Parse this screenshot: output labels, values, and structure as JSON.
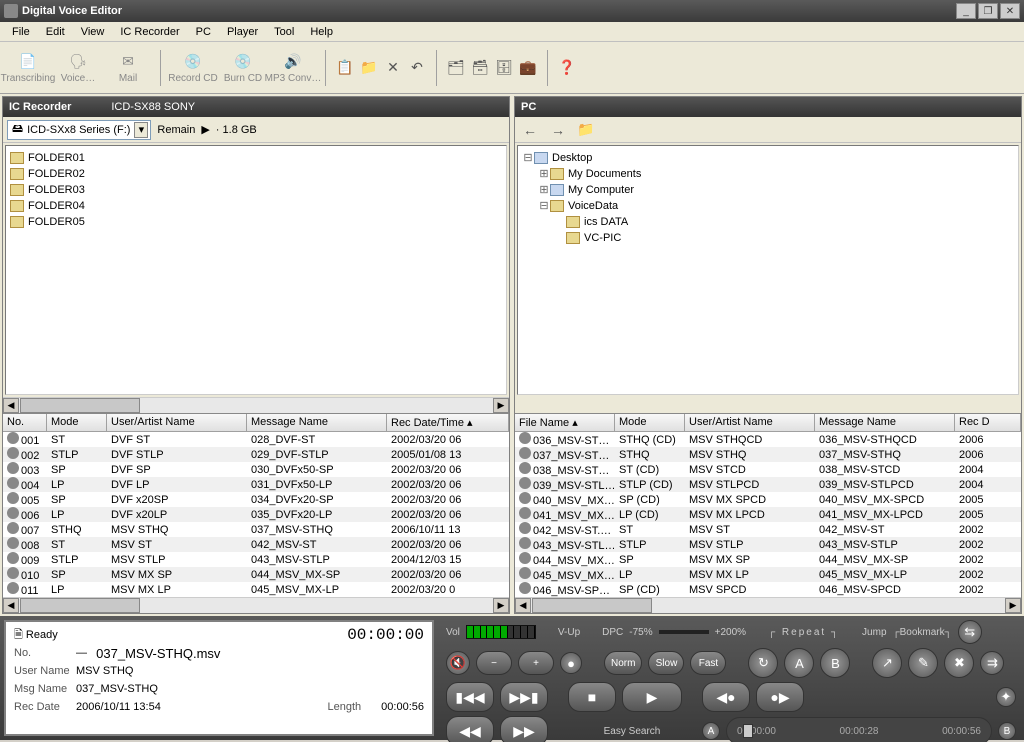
{
  "window": {
    "title": "Digital Voice Editor"
  },
  "menu": [
    "File",
    "Edit",
    "View",
    "IC Recorder",
    "PC",
    "Player",
    "Tool",
    "Help"
  ],
  "toolbar": {
    "transcribing": "Transcribing",
    "voice": "Voice…",
    "mail": "Mail",
    "record_cd": "Record CD",
    "burn_cd": "Burn CD",
    "mp3": "MP3 Conv…"
  },
  "left": {
    "title": "IC Recorder",
    "model": "ICD-SX88 SONY",
    "device": "ICD-SXx8 Series (F:)",
    "remain_label": "Remain",
    "remain_value": "· 1.8 GB",
    "folders": [
      "FOLDER01",
      "FOLDER02",
      "FOLDER03",
      "FOLDER04",
      "FOLDER05"
    ],
    "cols": [
      "No.",
      "Mode",
      "User/Artist Name",
      "Message Name",
      "Rec Date/Time"
    ],
    "rows": [
      [
        "001",
        "ST",
        "DVF ST",
        "028_DVF-ST",
        "2002/03/20 06"
      ],
      [
        "002",
        "STLP",
        "DVF STLP",
        "029_DVF-STLP",
        "2005/01/08 13"
      ],
      [
        "003",
        "SP",
        "DVF SP",
        "030_DVFx50-SP",
        "2002/03/20 06"
      ],
      [
        "004",
        "LP",
        "DVF LP",
        "031_DVFx50-LP",
        "2002/03/20 06"
      ],
      [
        "005",
        "SP",
        "DVF x20SP",
        "034_DVFx20-SP",
        "2002/03/20 06"
      ],
      [
        "006",
        "LP",
        "DVF x20LP",
        "035_DVFx20-LP",
        "2002/03/20 06"
      ],
      [
        "007",
        "STHQ",
        "MSV STHQ",
        "037_MSV-STHQ",
        "2006/10/11 13"
      ],
      [
        "008",
        "ST",
        "MSV ST",
        "042_MSV-ST",
        "2002/03/20 06"
      ],
      [
        "009",
        "STLP",
        "MSV STLP",
        "043_MSV-STLP",
        "2004/12/03 15"
      ],
      [
        "010",
        "SP",
        "MSV MX SP",
        "044_MSV_MX-SP",
        "2002/03/20 06"
      ],
      [
        "011",
        "LP",
        "MSV MX LP",
        "045_MSV_MX-LP",
        "2002/03/20 0"
      ]
    ]
  },
  "right": {
    "title": "PC",
    "tree": {
      "root": "Desktop",
      "items": [
        "My Documents",
        "My Computer",
        "VoiceData"
      ],
      "children": [
        "ics DATA",
        "VC-PIC"
      ]
    },
    "cols": [
      "File Name",
      "Mode",
      "User/Artist Name",
      "Message Name",
      "Rec D"
    ],
    "rows": [
      [
        "036_MSV-ST…",
        "STHQ (CD)",
        "MSV STHQCD",
        "036_MSV-STHQCD",
        "2006"
      ],
      [
        "037_MSV-ST…",
        "STHQ",
        "MSV STHQ",
        "037_MSV-STHQ",
        "2006"
      ],
      [
        "038_MSV-ST…",
        "ST (CD)",
        "MSV STCD",
        "038_MSV-STCD",
        "2004"
      ],
      [
        "039_MSV-STL…",
        "STLP (CD)",
        "MSV STLPCD",
        "039_MSV-STLPCD",
        "2004"
      ],
      [
        "040_MSV_MX…",
        "SP (CD)",
        "MSV MX SPCD",
        "040_MSV_MX-SPCD",
        "2005"
      ],
      [
        "041_MSV_MX…",
        "LP (CD)",
        "MSV MX LPCD",
        "041_MSV_MX-LPCD",
        "2005"
      ],
      [
        "042_MSV-ST.…",
        "ST",
        "MSV ST",
        "042_MSV-ST",
        "2002"
      ],
      [
        "043_MSV-STL…",
        "STLP",
        "MSV STLP",
        "043_MSV-STLP",
        "2002"
      ],
      [
        "044_MSV_MX…",
        "SP",
        "MSV MX SP",
        "044_MSV_MX-SP",
        "2002"
      ],
      [
        "045_MSV_MX…",
        "LP",
        "MSV MX LP",
        "045_MSV_MX-LP",
        "2002"
      ],
      [
        "046_MSV-SP…",
        "SP (CD)",
        "MSV SPCD",
        "046_MSV-SPCD",
        "2002"
      ]
    ]
  },
  "player": {
    "status": "Ready",
    "time": "00:00:00",
    "no_label": "No.",
    "no_value": "—",
    "file": "037_MSV-STHQ.msv",
    "user_label": "User Name",
    "user_value": "MSV STHQ",
    "msg_label": "Msg Name",
    "msg_value": "037_MSV-STHQ",
    "rec_label": "Rec Date",
    "rec_value": "2006/10/11 13:54",
    "length_label": "Length",
    "length_value": "00:00:56",
    "vol": "Vol",
    "vup": "V-Up",
    "dpc": "DPC",
    "dpc_low": "-75%",
    "dpc_high": "+200%",
    "norm": "Norm",
    "slow": "Slow",
    "fast": "Fast",
    "repeat": "Repeat",
    "jump": "Jump",
    "bookmark": "Bookmark",
    "easy": "Easy Search",
    "a": "A",
    "b": "B",
    "t0": "00:00:00",
    "t1": "00:00:28",
    "t2": "00:00:56"
  }
}
